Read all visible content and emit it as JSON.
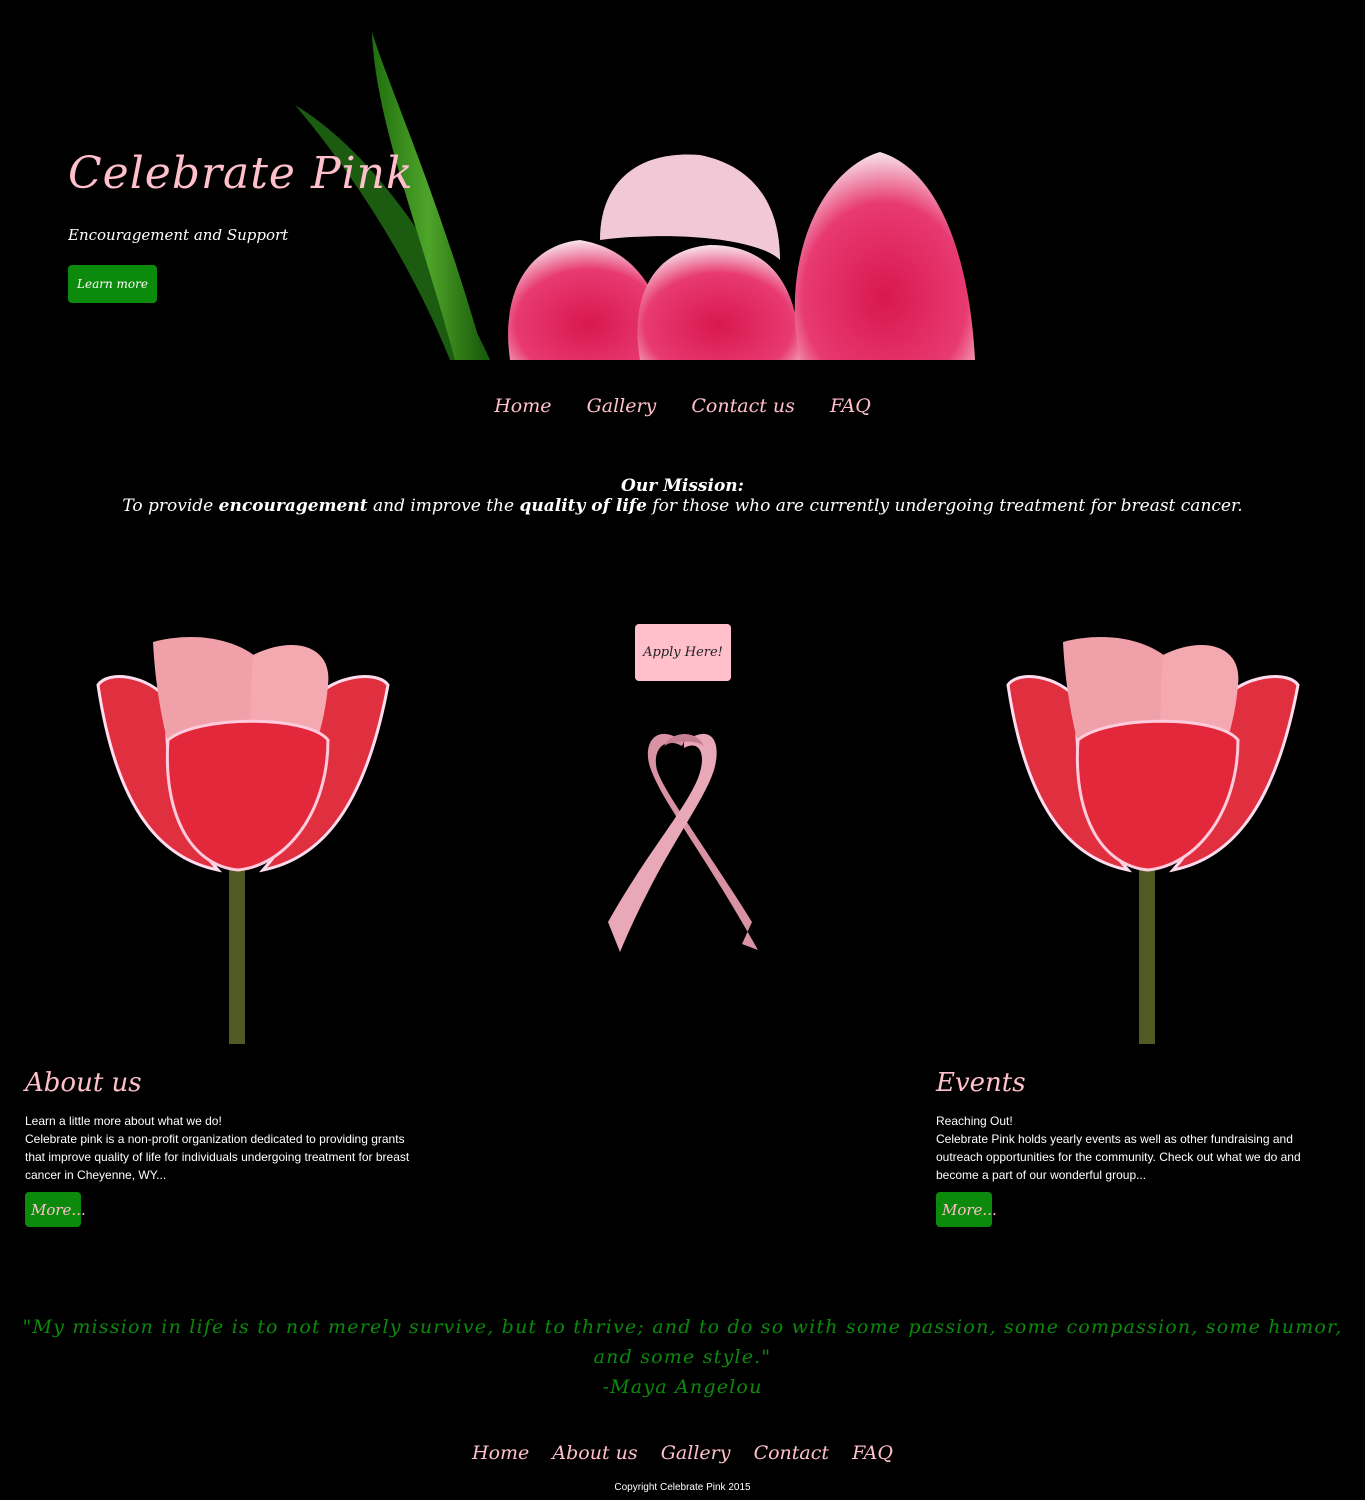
{
  "hero": {
    "title": "Celebrate Pink",
    "tagline": "Encouragement and Support",
    "learn_more": "Learn more"
  },
  "nav": {
    "items": [
      "Home",
      "Gallery",
      "Contact us",
      "FAQ"
    ]
  },
  "mission": {
    "heading": "Our Mission:",
    "text_1": "To provide ",
    "bold_1": "encouragement",
    "text_2": " and improve the ",
    "bold_2": "quality of life",
    "text_3": " for those who are currently undergoing treatment for breast cancer."
  },
  "apply": {
    "label": "Apply Here!"
  },
  "about": {
    "heading": "About us",
    "line1": "Learn a little more about what we do!",
    "body": "Celebrate pink is a non-profit organization dedicated to providing grants that improve quality of life for individuals undergoing treatment for breast cancer in Cheyenne, WY...",
    "more": "More..."
  },
  "events": {
    "heading": "Events",
    "line1": "Reaching Out!",
    "body": "Celebrate Pink holds yearly events as well as other fundraising and outreach opportunities for the community. Check out what we do and become a part of our wonderful group...",
    "more": "More..."
  },
  "quote": {
    "text": "\"My mission in life is to not merely survive, but to thrive; and to do so with some passion, some compassion, some humor, and some style.\"",
    "author": "-Maya Angelou"
  },
  "footer": {
    "nav": [
      "Home",
      "About us",
      "Gallery",
      "Contact",
      "FAQ"
    ],
    "copyright": "Copyright Celebrate Pink 2015"
  },
  "colors": {
    "pink": "#ffc0cb",
    "green": "#0b8a0b",
    "background": "#000000"
  }
}
